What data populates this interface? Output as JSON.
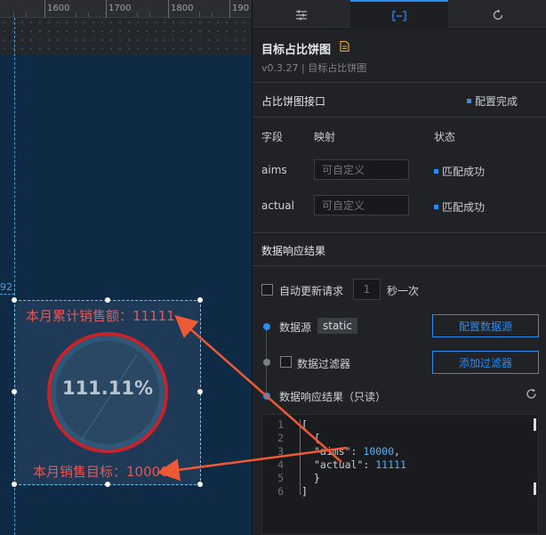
{
  "ruler": {
    "labels": [
      "1600",
      "1700",
      "1800",
      "190"
    ]
  },
  "canvas": {
    "guide_number": "92"
  },
  "widget": {
    "top_label": "本月累计销售额：11111",
    "bottom_label": "本月销售目标：10000",
    "percent_text": "111.11%",
    "ratio": 1.1111,
    "ring_color": "#c8232b"
  },
  "panel": {
    "tabs": [
      {
        "name": "settings",
        "icon": "sliders-icon"
      },
      {
        "name": "data",
        "icon": "bracket-icon"
      },
      {
        "name": "interaction",
        "icon": "rotate-icon"
      }
    ],
    "title": "目标占比饼图",
    "version": "v0.3.27 | 目标占比饼图",
    "section_title": "占比饼图接口",
    "config_status": "配置完成",
    "headers": {
      "field": "字段",
      "mapping": "映射",
      "status": "状态"
    },
    "fields": [
      {
        "name": "aims",
        "placeholder": "可自定义",
        "status": "匹配成功"
      },
      {
        "name": "actual",
        "placeholder": "可自定义",
        "status": "匹配成功"
      }
    ],
    "response_title": "数据响应结果",
    "auto_update_label": "自动更新请求",
    "interval_value": "1",
    "interval_unit": "秒一次",
    "datasource_label": "数据源",
    "datasource_type": "static",
    "config_datasource_button": "配置数据源",
    "filter_label": "数据过滤器",
    "add_filter_button": "添加过滤器",
    "result_label": "数据响应结果（只读）",
    "accent": "#2b8cf0"
  },
  "code": {
    "lines": [
      {
        "no": "1",
        "text": "["
      },
      {
        "no": "2",
        "text": "  {"
      },
      {
        "no": "3",
        "key": "\"aims\"",
        "value": "10000",
        "suffix": ","
      },
      {
        "no": "4",
        "key": "\"actual\"",
        "value": "11111",
        "suffix": ""
      },
      {
        "no": "5",
        "text": "  }"
      },
      {
        "no": "6",
        "text": "]"
      }
    ]
  }
}
